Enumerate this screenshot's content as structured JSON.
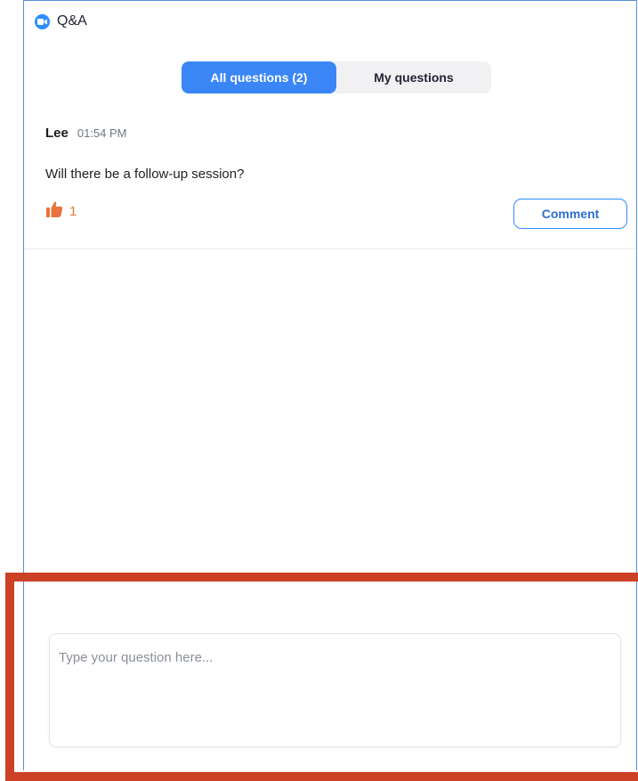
{
  "window": {
    "title": "Q&A",
    "app_icon": "zoom-camera-icon"
  },
  "tabs": [
    {
      "label": "All questions (2)",
      "active": true
    },
    {
      "label": "My questions",
      "active": false
    }
  ],
  "questions": [
    {
      "author": "Lee",
      "time": "01:54 PM",
      "text": "Will there be a follow-up session?",
      "likes": "1",
      "like_icon": "thumbs-up-icon",
      "comment_label": "Comment"
    }
  ],
  "composer": {
    "placeholder": "Type your question here..."
  },
  "colors": {
    "accent": "#3b86f7",
    "like": "#e8743b",
    "highlight": "#cc4125"
  }
}
